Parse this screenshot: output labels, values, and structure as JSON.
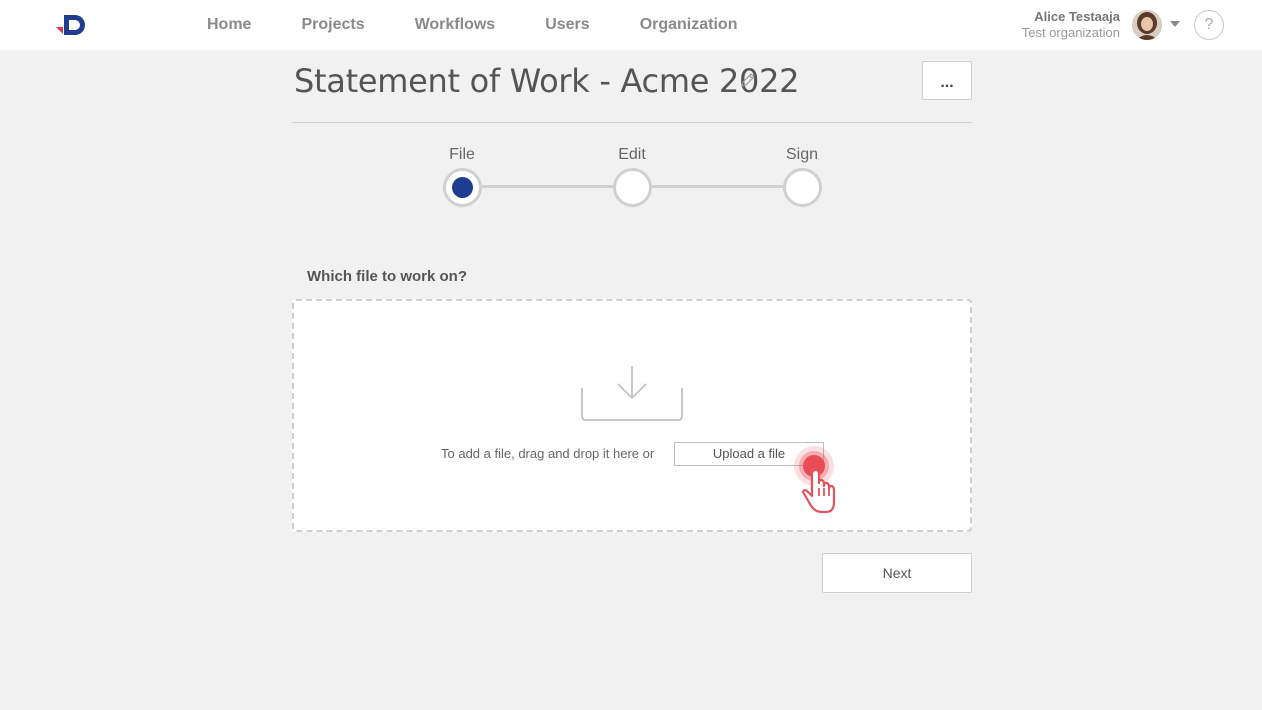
{
  "nav": {
    "items": [
      {
        "label": "Home"
      },
      {
        "label": "Projects"
      },
      {
        "label": "Workflows"
      },
      {
        "label": "Users"
      },
      {
        "label": "Organization"
      }
    ]
  },
  "user": {
    "name": "Alice Testaaja",
    "organization": "Test organization"
  },
  "help": {
    "label": "?"
  },
  "document": {
    "title": "Statement of Work - Acme 2022",
    "more_label": "..."
  },
  "steps": [
    {
      "label": "File",
      "active": true
    },
    {
      "label": "Edit",
      "active": false
    },
    {
      "label": "Sign",
      "active": false
    }
  ],
  "file_section": {
    "question": "Which file to work on?",
    "drop_text": "To add a file, drag and drop it here or",
    "upload_label": "Upload a file"
  },
  "actions": {
    "next_label": "Next"
  },
  "colors": {
    "accent": "#1f3d8f",
    "brand_red": "#e0364a",
    "cursor_highlight": "#e84c55"
  }
}
